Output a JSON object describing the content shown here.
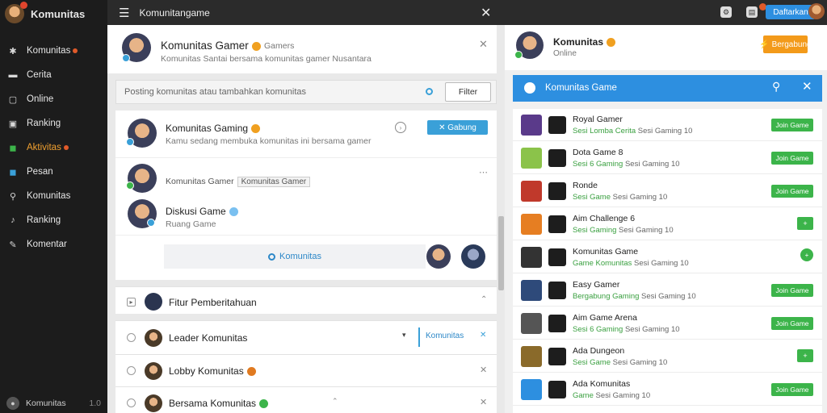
{
  "app": {
    "brand": "Komunitas",
    "window_title": "Komunitangame",
    "topbar_button": "Daftarkan"
  },
  "sidebar": {
    "items": [
      {
        "label": "Komunitas",
        "icon": "community-icon",
        "active": false,
        "dot": true
      },
      {
        "label": "Cerita",
        "icon": "story-icon",
        "active": false
      },
      {
        "label": "Online",
        "icon": "online-icon",
        "active": false
      },
      {
        "label": "Ranking",
        "icon": "ranking-icon",
        "active": false
      },
      {
        "label": "Aktivitas",
        "icon": "activity-icon",
        "active": true,
        "dot": true
      },
      {
        "label": "Pesan",
        "icon": "message-icon",
        "active": false
      },
      {
        "label": "Komunitas",
        "icon": "search-icon",
        "active": false
      },
      {
        "label": "Ranking",
        "icon": "mic-icon",
        "active": false
      },
      {
        "label": "Komentar",
        "icon": "pen-icon",
        "active": false
      }
    ],
    "footer": {
      "label": "Komunitas",
      "version": "1.0"
    }
  },
  "middle": {
    "profile": {
      "name": "Komunitas Gamer",
      "sub_label": "Gamers",
      "desc": "Komunitas Santai bersama komunitas gamer Nusantara"
    },
    "search": {
      "placeholder": "Posting komunitas atau tambahkan komunitas",
      "button": "Filter"
    },
    "post1": {
      "name": "Komunitas Gaming",
      "desc": "Kamu sedang membuka komunitas ini bersama gamer",
      "button": "Gabung"
    },
    "post2": {
      "text": "Komunitas Gamer",
      "chip": "Komunitas Gamer"
    },
    "post3": {
      "name": "Diskusi Game",
      "sub": "Ruang Game"
    },
    "join_label": "Komunitas",
    "rows": [
      {
        "label": "Fitur Pemberitahuan"
      },
      {
        "label": "Leader Komunitas",
        "link": "Komunitas"
      },
      {
        "label": "Lobby Komunitas"
      },
      {
        "label": "Bersama Komunitas"
      }
    ]
  },
  "right": {
    "header": {
      "name": "Komunitas",
      "sub": "Online",
      "button": "Bergabung"
    },
    "banner": {
      "title": "Komunitas Game"
    },
    "items": [
      {
        "name": "Royal Gamer",
        "meta": "Sesi Lomba Cerita",
        "btn": "Join Game",
        "btype": "wide"
      },
      {
        "name": "Dota Game 8",
        "meta": "Sesi 6 Gaming",
        "btn": "Join Game",
        "btype": "wide"
      },
      {
        "name": "Ronde",
        "meta": "Sesi Game",
        "btn": "Join Game",
        "btype": "wide"
      },
      {
        "name": "Aim Challenge 6",
        "meta": "Sesi Gaming",
        "btn": "+",
        "btype": "square"
      },
      {
        "name": "Komunitas Game",
        "meta": "Game Komunitas",
        "btn": "+",
        "btype": "circle"
      },
      {
        "name": "Easy Gamer",
        "meta": "Bergabung Gaming",
        "btn": "Join Game",
        "btype": "wide"
      },
      {
        "name": "Aim Game Arena",
        "meta": "Sesi 6 Gaming",
        "btn": "Join Game",
        "btype": "wide"
      },
      {
        "name": "Ada Dungeon",
        "meta": "Sesi Game",
        "btn": "+",
        "btype": "square"
      },
      {
        "name": "Ada Komunitas",
        "meta": "Game",
        "btn": "Join Game",
        "btype": "wide"
      }
    ],
    "meta_extra": "Sesi Gaming 10",
    "tile_colors": [
      "#5a3a8a",
      "#8bc34a",
      "#c0392b",
      "#e67e22",
      "#333333",
      "#2e4a7a",
      "#555555",
      "#8a6a2a",
      "#2d8fe0"
    ]
  }
}
